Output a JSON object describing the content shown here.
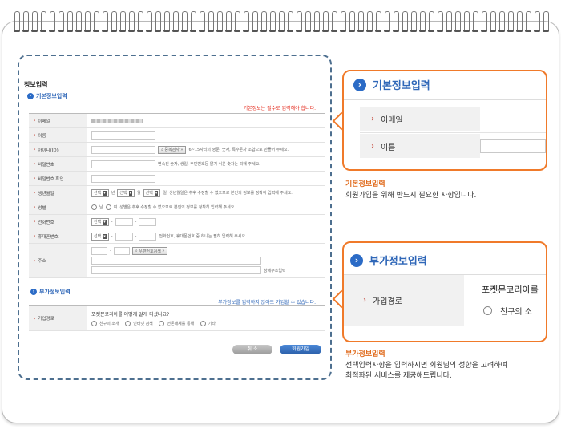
{
  "form": {
    "title": "정보입력",
    "basic_section": "기본정보입력",
    "required_note": "기본정보는 필수로 입력해야 합니다.",
    "rows": {
      "email": "이메일",
      "name": "이름",
      "id": "아이디(ID)",
      "id_check_button": "중복검사",
      "id_help": "6~15자리의 영문, 숫자, 특수문자 조합으로 만들어 주세요.",
      "password": "비밀번호",
      "password_help": "연속된 숫자, 생일, 주민번호등 알기 쉬운 숫자는 피해 주세요.",
      "password_confirm": "비밀번호 확인",
      "birthday": "생년월일",
      "select_label": "선택",
      "year": "년",
      "month": "월",
      "day": "일",
      "birthday_help": "생년월일은 추후 수정할 수 없으므로 본인의 정보를 정확히 입력해 주세요.",
      "gender": "성별",
      "male": "남",
      "female": "여",
      "gender_help": "성별은 추후 수정할 수 없으므로 본인의 정보를 정확히 입력해 주세요.",
      "phone": "전화번호",
      "mobile": "휴대폰번호",
      "mobile_help": "전화번호, 휴대폰번호 중 하나는 필히 입력해 주세요.",
      "dash": "-",
      "address": "주소",
      "zip_search_button": "우편번호검색",
      "detail_address": "상세주소입력"
    },
    "optional_section": "부가정보입력",
    "optional_note": "부가정보를 입력하지 않아도 가입할 수 있습니다.",
    "join_path": "가입경로",
    "join_question": "포켓몬코리아를 어떻게 알게 되셨나요?",
    "join_options": [
      "친구의 소개",
      "인터넷 검색",
      "언론매체를 통해",
      "기타"
    ],
    "cancel_button": "취 소",
    "join_button": "회원가입"
  },
  "callout_basic": {
    "heading": "기본정보입력",
    "email_label": "이메일",
    "name_label": "이름",
    "desc_title": "기본정보입력",
    "desc_text": "회원가입을 위해 반드시 필요한 사항입니다."
  },
  "callout_optional": {
    "heading": "부가정보입력",
    "join_path_label": "가입경로",
    "question_partial": "포켓몬코리아를",
    "option_partial": "친구의 소",
    "desc_title": "부가정보입력",
    "desc_text_1": "선택입력사항을 입력하시면 회원님의 성향을 고려하여",
    "desc_text_2": "최적화된 서비스를 제공해드립니다."
  },
  "colors": {
    "accent_blue": "#2f67b8",
    "callout_border": "#f07a2a",
    "required_red": "#e4291c"
  }
}
